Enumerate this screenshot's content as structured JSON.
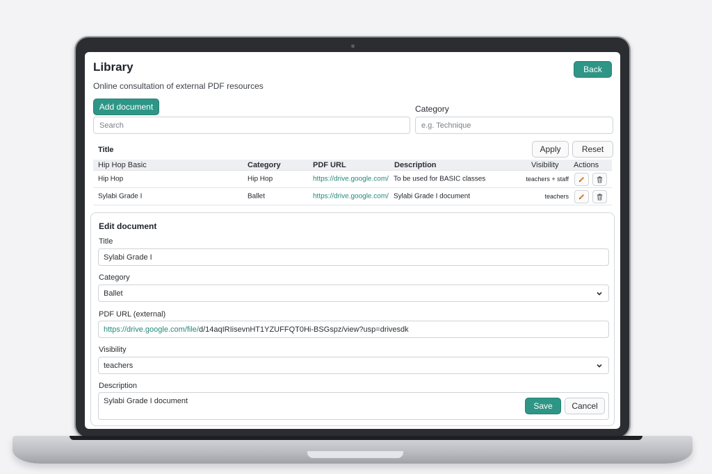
{
  "app": {
    "title": "Library",
    "subtitle": "Online consultation of external PDF resources",
    "back_label": "Back"
  },
  "toolbar": {
    "add_label": "Add document",
    "category_label": "Category",
    "search_placeholder": "Search",
    "category_placeholder": "e.g. Technique"
  },
  "filters": {
    "title_label": "Title",
    "apply_label": "Apply",
    "reset_label": "Reset"
  },
  "table": {
    "columns": {
      "title": "Hip Hop Basic",
      "category": "Category",
      "url": "PDF URL",
      "description": "Description",
      "visibility": "Visibility",
      "actions": "Actions"
    },
    "rows": [
      {
        "title": "Hip Hop",
        "category": "Hip Hop",
        "url": "https://drive.google.com/",
        "description": "To be used for BASIC classes",
        "visibility": "teachers + staff"
      },
      {
        "title": "Sylabi Grade I",
        "category": "Ballet",
        "url": "https://drive.google.com/",
        "description": "Sylabi Grade I document",
        "visibility": "teachers"
      }
    ]
  },
  "edit": {
    "heading": "Edit document",
    "title_label": "Title",
    "title_value": "Sylabi Grade I",
    "category_label": "Category",
    "category_value": "Ballet",
    "url_label": "PDF URL (external)",
    "url_value_link": "https://drive.google.com/file/",
    "url_value_rest": "d/14aqIRIisevnHT1YZUFFQT0Hi-BSGspz/view?usp=drivesdk",
    "visibility_label": "Visibility",
    "visibility_value": "teachers",
    "description_label": "Description",
    "description_value": "Sylabi Grade I document",
    "save_label": "Save",
    "cancel_label": "Cancel"
  },
  "colors": {
    "accent": "#2e9686",
    "link": "#23897b",
    "edit_icon": "#e08a3a",
    "delete_icon": "#5b6068"
  },
  "icons": [
    "pencil-icon",
    "trash-icon",
    "chevron-down-icon"
  ]
}
